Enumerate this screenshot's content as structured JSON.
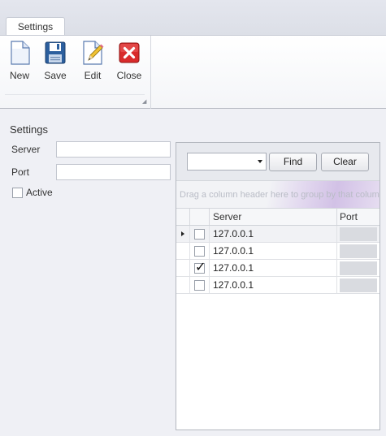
{
  "ribbon": {
    "tab_label": "Settings",
    "buttons": {
      "new": "New",
      "save": "Save",
      "edit": "Edit",
      "close": "Close"
    }
  },
  "form": {
    "title": "Settings",
    "server_label": "Server",
    "server_value": "",
    "port_label": "Port",
    "port_value": "",
    "active_label": "Active",
    "active_checked": false
  },
  "grid": {
    "filter_value": "",
    "find_label": "Find",
    "clear_label": "Clear",
    "group_panel_text": "Drag a column header here to group by that column",
    "columns": [
      "Server",
      "Port"
    ],
    "rows": [
      {
        "server": "127.0.0.1",
        "checked": false,
        "current": true
      },
      {
        "server": "127.0.0.1",
        "checked": false,
        "current": false
      },
      {
        "server": "127.0.0.1",
        "checked": true,
        "current": false
      },
      {
        "server": "127.0.0.1",
        "checked": false,
        "current": false
      }
    ]
  },
  "colors": {
    "close_icon": "#d92b2b",
    "save_icon": "#2c5f9e",
    "group_panel_accent": "#d2c1e6"
  },
  "icons": {
    "new": "new-document-icon",
    "save": "floppy-disk-icon",
    "edit": "edit-pencil-icon",
    "close": "close-x-icon"
  }
}
